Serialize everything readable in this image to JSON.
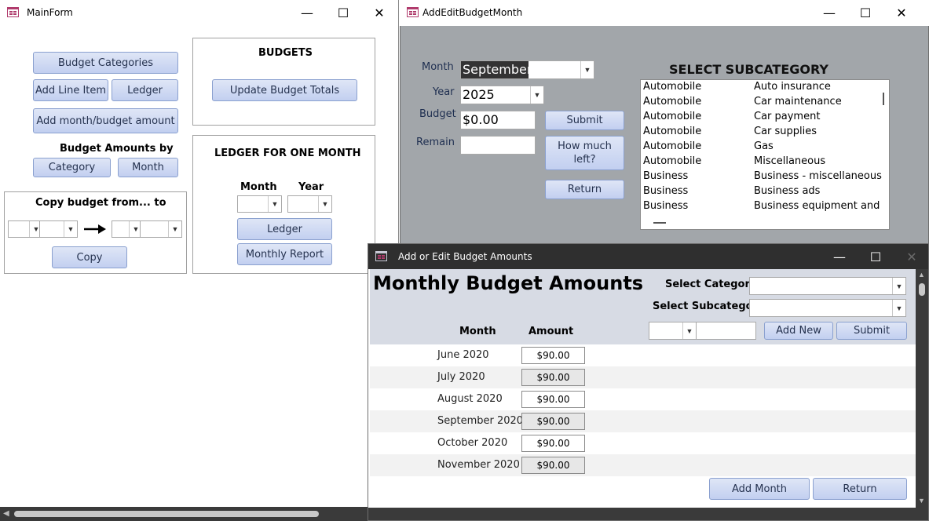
{
  "main_form": {
    "title": "MainForm",
    "buttons": {
      "budget_categories": "Budget Categories",
      "add_line_item": "Add Line Item",
      "ledger": "Ledger",
      "add_month_budget": "Add month/budget amount",
      "category": "Category",
      "month": "Month",
      "copy": "Copy",
      "update_budget_totals": "Update Budget Totals",
      "ledger2": "Ledger",
      "monthly_report": "Monthly Report"
    },
    "budget_amounts_by": "Budget Amounts by",
    "copy_budget_label": "Copy budget from... to",
    "budgets_heading": "BUDGETS",
    "ledger_heading": "LEDGER FOR ONE MONTH",
    "ledger_month_label": "Month",
    "ledger_year_label": "Year"
  },
  "add_edit_month": {
    "title": "AddEditBudgetMonth",
    "labels": {
      "month": "Month",
      "year": "Year",
      "budget": "Budget",
      "remain": "Remain"
    },
    "month_value": "September",
    "year_value": "2025",
    "budget_value": "$0.00",
    "remain_value": "",
    "buttons": {
      "submit": "Submit",
      "how_much": "How much left?",
      "return": "Return"
    },
    "subcategory_heading": "SELECT SUBCATEGORY",
    "subcategories": [
      {
        "category": "Automobile",
        "subcategory": "Auto insurance"
      },
      {
        "category": "Automobile",
        "subcategory": "Car maintenance"
      },
      {
        "category": "Automobile",
        "subcategory": "Car payment"
      },
      {
        "category": "Automobile",
        "subcategory": "Car supplies"
      },
      {
        "category": "Automobile",
        "subcategory": "Gas"
      },
      {
        "category": "Automobile",
        "subcategory": "Miscellaneous"
      },
      {
        "category": "Business",
        "subcategory": "Business - miscellaneous"
      },
      {
        "category": "Business",
        "subcategory": "Business ads"
      },
      {
        "category": "Business",
        "subcategory": "Business equipment and"
      }
    ]
  },
  "budget_amounts": {
    "title": "Add or Edit Budget Amounts",
    "heading": "Monthly Budget Amounts",
    "select_category_label": "Select Category",
    "select_subcategory_label": "Select Subcategory",
    "col_month": "Month",
    "col_amount": "Amount",
    "buttons": {
      "add_new": "Add New",
      "submit": "Submit",
      "add_month": "Add Month",
      "return": "Return"
    },
    "rows": [
      {
        "month": "June 2020",
        "amount": "$90.00"
      },
      {
        "month": "July 2020",
        "amount": "$90.00"
      },
      {
        "month": "August 2020",
        "amount": "$90.00"
      },
      {
        "month": "September 2020",
        "amount": "$90.00"
      },
      {
        "month": "October 2020",
        "amount": "$90.00"
      },
      {
        "month": "November 2020",
        "amount": "$90.00"
      }
    ]
  },
  "window_controls": {
    "minimize": "—",
    "maximize": "☐",
    "close": "✕"
  },
  "icons": {
    "dropdown": "chevron-down-icon",
    "arrow": "arrow-right-icon",
    "app": "form-icon"
  }
}
